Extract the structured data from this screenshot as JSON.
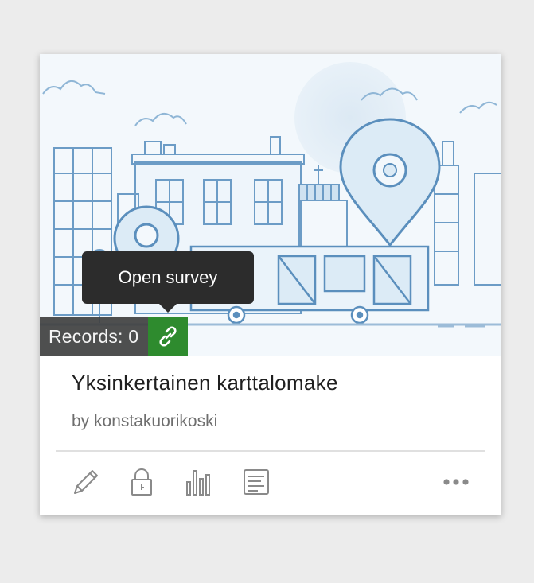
{
  "card": {
    "records_label": "Records: 0",
    "tooltip": "Open survey",
    "title": "Yksinkertainen karttalomake",
    "owner": "by konstakuorikoski"
  },
  "colors": {
    "link_button": "#2e8b2e",
    "illustration_line": "#5b8fbd",
    "illustration_fill": "#dcebf6",
    "icon_gray": "#8a8a8a"
  },
  "actions": [
    {
      "icon": "pencil-icon",
      "purpose": "edit"
    },
    {
      "icon": "lock-icon",
      "purpose": "sharing"
    },
    {
      "icon": "bar-chart-icon",
      "purpose": "analyze"
    },
    {
      "icon": "document-icon",
      "purpose": "data"
    },
    {
      "icon": "more-icon",
      "purpose": "more"
    }
  ]
}
